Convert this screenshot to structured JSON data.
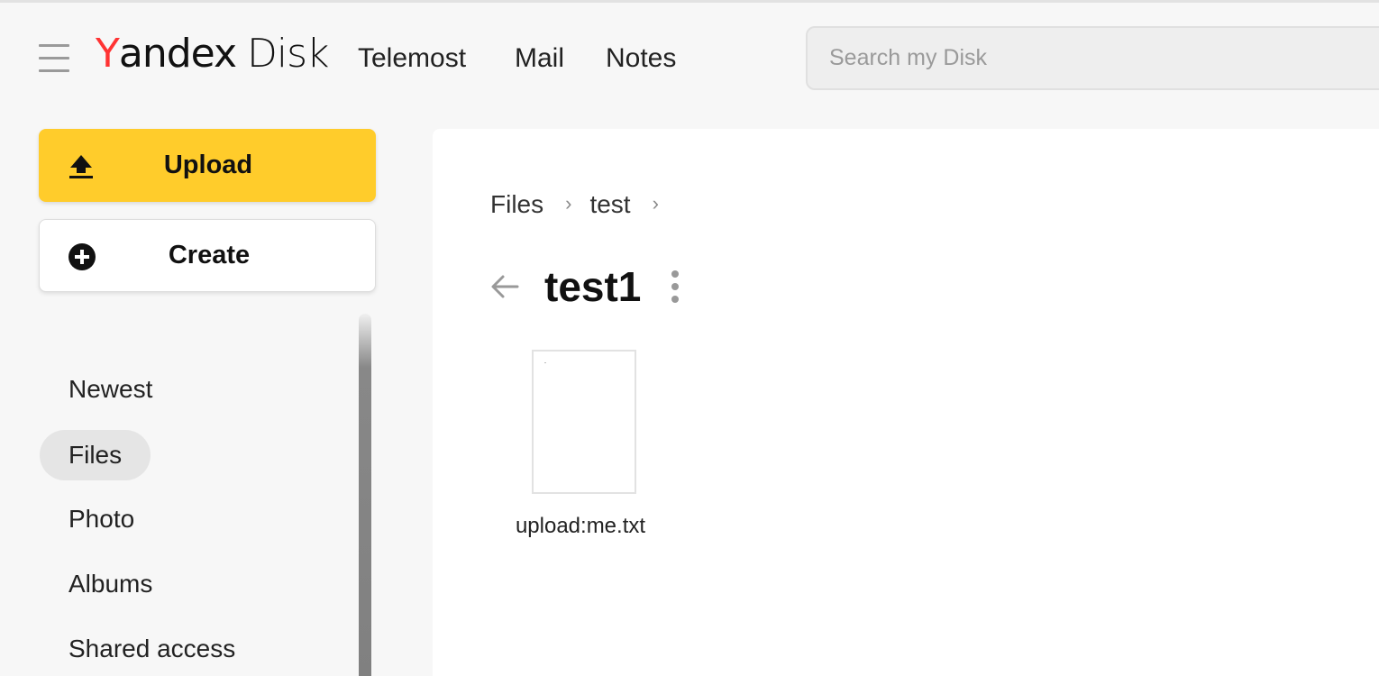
{
  "header": {
    "logo": {
      "y": "Y",
      "andex": "andex",
      "disk": "Disk"
    },
    "services": [
      "Telemost",
      "Mail",
      "Notes"
    ],
    "search_placeholder": "Search my Disk",
    "accent_color": "#ffcc2b",
    "logo_y_color": "#ff3333"
  },
  "sidebar": {
    "upload_label": "Upload",
    "create_label": "Create",
    "items": [
      {
        "label": "Newest",
        "active": false
      },
      {
        "label": "Files",
        "active": true
      },
      {
        "label": "Photo",
        "active": false
      },
      {
        "label": "Albums",
        "active": false
      },
      {
        "label": "Shared access",
        "active": false
      }
    ]
  },
  "main": {
    "breadcrumbs": [
      "Files",
      "test"
    ],
    "breadcrumb_separator": "›",
    "folder_title": "test1",
    "files": [
      {
        "name": "upload:me.txt",
        "icon": "text-file-icon"
      }
    ]
  }
}
